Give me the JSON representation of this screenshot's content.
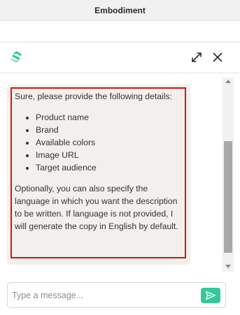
{
  "window": {
    "title": "Embodiment"
  },
  "header": {
    "logo_icon": "brand-logo-icon",
    "expand_icon": "expand-icon",
    "close_icon": "close-icon",
    "brand_color": "#2cc79b"
  },
  "message": {
    "intro": "Sure, please provide the following details:",
    "details": [
      "Product name",
      "Brand",
      "Available colors",
      "Image URL",
      "Target audience"
    ],
    "outro": "Optionally, you can also specify the language in which you want the description to be written. If language is not provided, I will generate the copy in English by default.",
    "bubble_color": "#f1f0ec",
    "highlight_color": "#d9110f"
  },
  "composer": {
    "placeholder": "Type a message...",
    "value": "",
    "send_icon": "send-icon",
    "send_color": "#34c89a"
  }
}
